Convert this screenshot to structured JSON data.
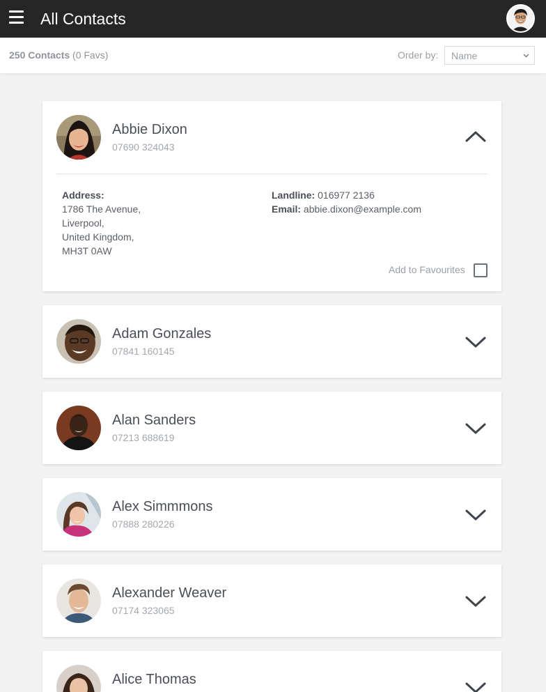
{
  "header": {
    "title": "All Contacts",
    "menu_icon": "hamburger-menu-icon",
    "profile_avatar": "user-avatar"
  },
  "toolbar": {
    "count_bold": "250 Contacts",
    "count_favs": " (0 Favs)",
    "order_label": "Order by:",
    "order_value": "Name"
  },
  "contacts": [
    {
      "name": "Abbie Dixon",
      "phone": "07690 324043",
      "expanded": true,
      "address_label": "Address:",
      "address_lines": [
        "1786 The Avenue,",
        "Liverpool,",
        "United Kingdom,",
        "MH3T 0AW"
      ],
      "landline_label": "Landline:",
      "landline": "016977 2136",
      "email_label": "Email:",
      "email": "abbie.dixon@example.com",
      "favourite_label": "Add to Favourites",
      "favourite": false
    },
    {
      "name": "Adam Gonzales",
      "phone": "07841 160145",
      "expanded": false
    },
    {
      "name": "Alan Sanders",
      "phone": "07213 688619",
      "expanded": false
    },
    {
      "name": "Alex Simmmons",
      "phone": "07888 280226",
      "expanded": false
    },
    {
      "name": "Alexander Weaver",
      "phone": "07174 323065",
      "expanded": false
    },
    {
      "name": "Alice Thomas",
      "phone": "",
      "expanded": false
    }
  ],
  "icons": {
    "collapse": "chevron-up-icon",
    "expand": "chevron-down-icon",
    "select": "select-chevron-icon"
  },
  "colors": {
    "header_bg": "#262626",
    "page_bg": "#f2f2f2",
    "card_bg": "#ffffff",
    "text_primary": "#4a4f57",
    "text_muted": "#a3a8ae"
  }
}
